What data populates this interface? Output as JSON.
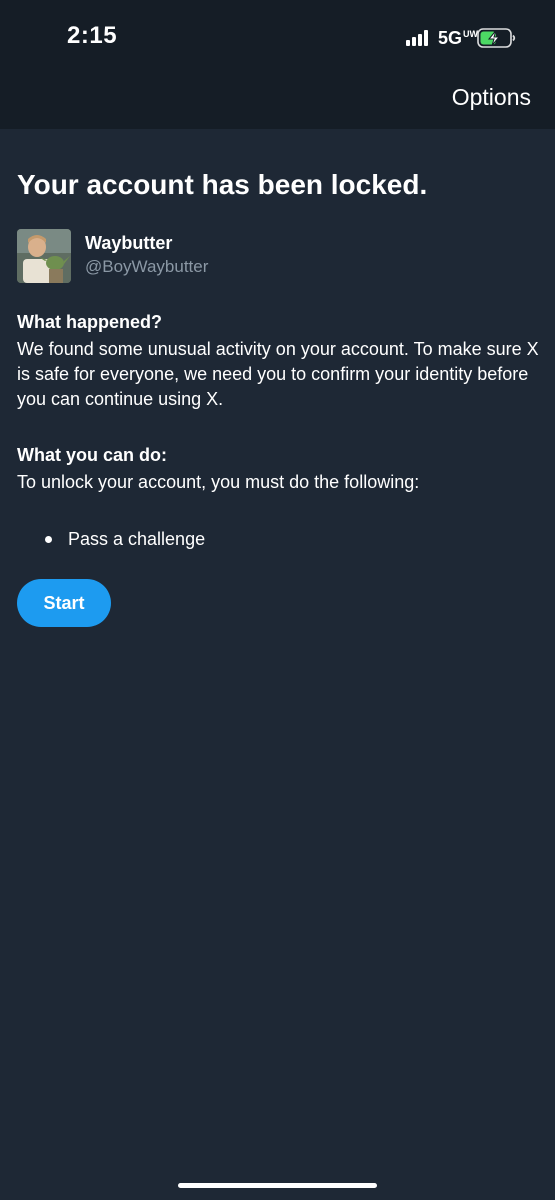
{
  "status_bar": {
    "time": "2:15",
    "network": "5G",
    "network_suffix": "UW",
    "signal_bars": 4,
    "battery_level": 0.55,
    "battery_charging": true,
    "battery_color": "#4cd964"
  },
  "header": {
    "options_label": "Options"
  },
  "main": {
    "title": "Your account has been locked.",
    "account": {
      "name": "Waybutter",
      "handle": "@BoyWaybutter"
    },
    "what_happened": {
      "title": "What happened?",
      "body": "We found some unusual activity on your account. To make sure X is safe for everyone, we need you to confirm your identity before you can continue using X."
    },
    "what_you_can_do": {
      "title": "What you can do:",
      "body": "To unlock your account, you must do the following:",
      "steps": [
        "Pass a challenge"
      ]
    },
    "start_label": "Start"
  },
  "colors": {
    "background": "#1e2835",
    "header_background": "#151d26",
    "accent": "#1d9bf0",
    "secondary_text": "#8b98a5"
  }
}
